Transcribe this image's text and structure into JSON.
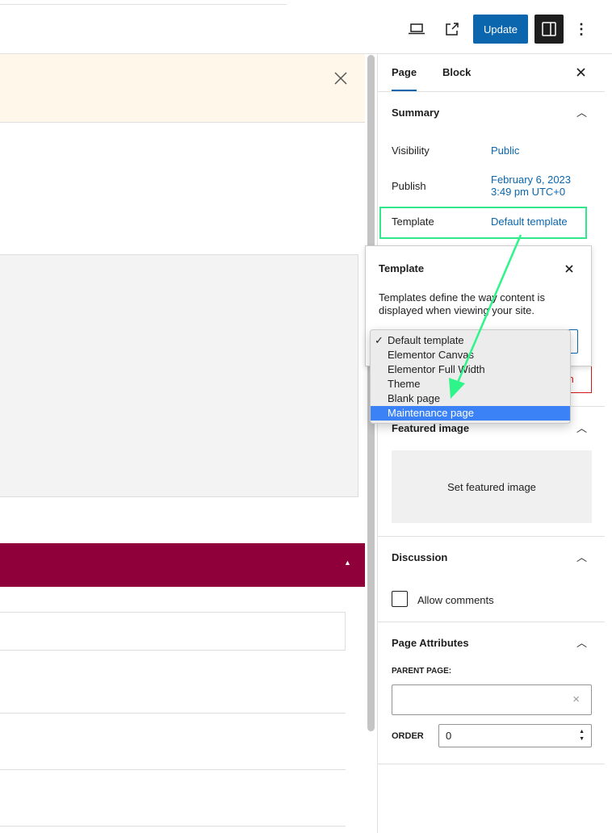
{
  "toolbar": {
    "update_label": "Update",
    "icons": [
      "laptop-icon",
      "external-link-icon",
      "sidebar-toggle-icon",
      "more-vertical-icon"
    ]
  },
  "sidebar": {
    "tabs": [
      {
        "label": "Page",
        "active": true
      },
      {
        "label": "Block",
        "active": false
      }
    ],
    "summary": {
      "title": "Summary",
      "visibility_label": "Visibility",
      "visibility_value": "Public",
      "publish_label": "Publish",
      "publish_date": "February 6, 2023",
      "publish_time": "3:49 pm UTC+0",
      "template_label": "Template",
      "template_value": "Default template"
    },
    "trash_partial": "sh",
    "featured_image": {
      "title": "Featured image",
      "button": "Set featured image"
    },
    "discussion": {
      "title": "Discussion",
      "allow_comments": "Allow comments",
      "checked": false
    },
    "attributes": {
      "title": "Page Attributes",
      "parent_label": "PARENT PAGE:",
      "parent_value": "",
      "order_label": "ORDER",
      "order_value": "0"
    }
  },
  "popover": {
    "title": "Template",
    "description": "Templates define the way content is displayed when viewing your site."
  },
  "dropdown": {
    "options": [
      "Default template",
      "Elementor Canvas",
      "Elementor Full Width",
      "Theme",
      "Blank page",
      "Maintenance page"
    ],
    "selected": "Default template",
    "highlighted": "Maintenance page"
  },
  "colors": {
    "accent": "#0b66ad",
    "highlight_box": "#2ee88a",
    "arrow": "#2ef58a",
    "maroon": "#8f003a"
  }
}
